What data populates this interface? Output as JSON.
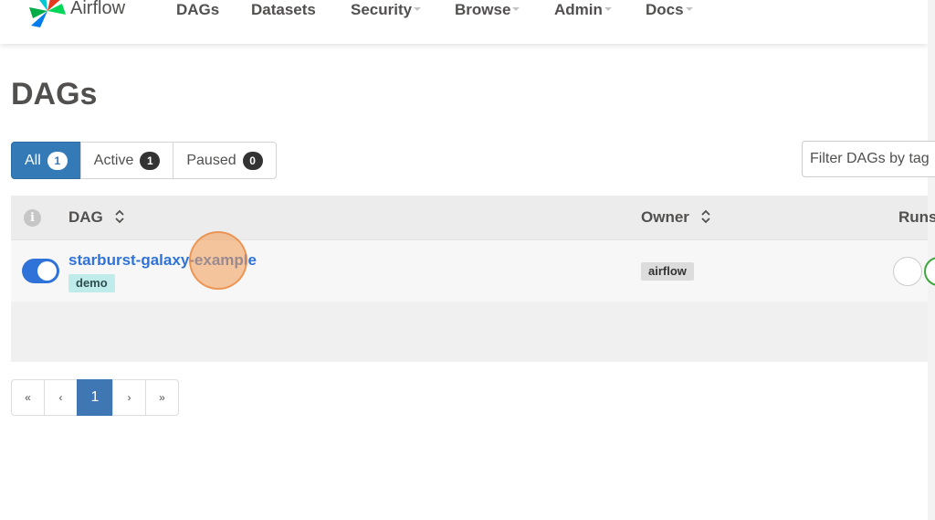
{
  "navbar": {
    "brand": "Airflow",
    "items": [
      {
        "label": "DAGs",
        "dropdown": false
      },
      {
        "label": "Datasets",
        "dropdown": false
      },
      {
        "label": "Security",
        "dropdown": true
      },
      {
        "label": "Browse",
        "dropdown": true
      },
      {
        "label": "Admin",
        "dropdown": true
      },
      {
        "label": "Docs",
        "dropdown": true
      }
    ]
  },
  "page": {
    "title": "DAGs"
  },
  "filters": {
    "all": {
      "label": "All",
      "count": "1",
      "active": true
    },
    "active": {
      "label": "Active",
      "count": "1"
    },
    "paused": {
      "label": "Paused",
      "count": "0"
    },
    "tag_placeholder": "Filter DAGs by tag"
  },
  "table": {
    "columns": {
      "dag": "DAG",
      "owner": "Owner",
      "runs": "Runs"
    },
    "rows": [
      {
        "dag_id": "starburst-galaxy-example",
        "tag": "demo",
        "owner": "airflow",
        "enabled": true
      }
    ]
  },
  "pagination": {
    "first": "«",
    "prev": "‹",
    "current": "1",
    "next": "›",
    "last": "»"
  },
  "colors": {
    "accent": "#2f73d8",
    "active_filter": "#337ab7",
    "tag_bg": "#bfeceb",
    "click_marker": "#f39c53"
  }
}
